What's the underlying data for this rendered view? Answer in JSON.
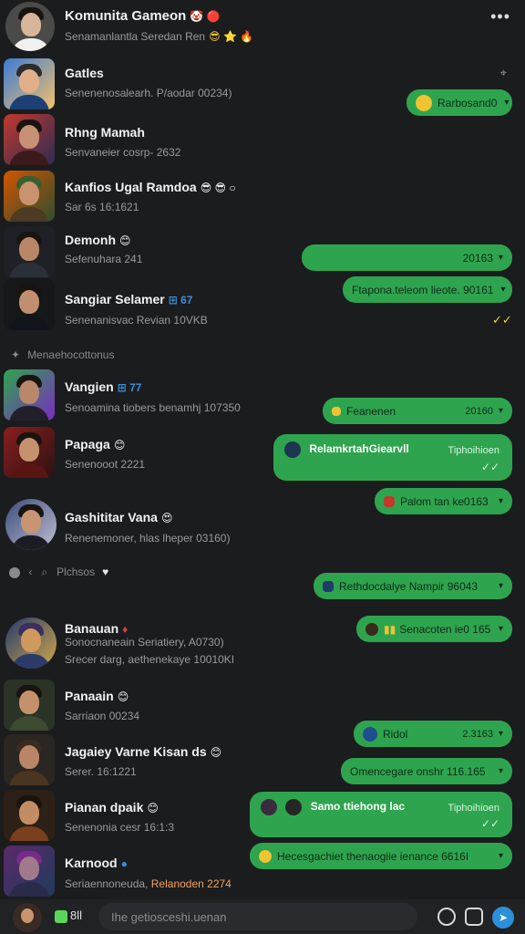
{
  "header": {
    "title": "Komunita Gameon",
    "subtitle": "Senamanlantla Seredan Ren"
  },
  "contacts": [
    {
      "name": "Gatles",
      "sub": "Senenenosalearh. P/aodar 00234)"
    },
    {
      "name": "Rhng Mamah",
      "sub": "Senvaneier cosrp- 2632"
    },
    {
      "name": "Kanfios Ugal Ramdoa",
      "sub": "Sar 6s 16:1621"
    },
    {
      "name": "Demonh",
      "sub": "Sefenuhara 241"
    },
    {
      "name": "Sangiar Selamer",
      "sub": "Senenanisvac Revian 10VKB"
    },
    {
      "name": "Vangien",
      "sub": "Senoamina tiobers benamhj 107350"
    },
    {
      "name": "Papaga",
      "sub": "Senenooot 2221"
    },
    {
      "name": "Gashititar Vana",
      "sub": "Renenemoner, hlas lheper 03160)"
    },
    {
      "name": "Banauan",
      "sub": "Sonocnaneain Seriatiery, A0730)"
    },
    {
      "name": "Panaain",
      "sub": "Sarriaon 00234"
    },
    {
      "name": "Jagaiey Varne Kisan ds",
      "sub": "Serer. 16:1221"
    },
    {
      "name": "Pianan dpaik",
      "sub": "Senenonia cesr 16:1:3"
    },
    {
      "name": "Karnood",
      "sub": "Seriaennoneuda,"
    }
  ],
  "extra_lines": {
    "banauan_line2": "Srecer darg, aethenekaye 10010KI",
    "karnood_highlight": "Relanoden 2274"
  },
  "separators": {
    "first": "Menaehocottonus",
    "second": "Plchsos"
  },
  "bubbles": {
    "b1": "Rarbosand0",
    "b2": "20163",
    "b3": "Ftapona.teleom lieote. 90161",
    "b4_text": "Feanenen",
    "b4_time": "20160",
    "b5_head": "RelamkrtahGiearvll",
    "b5_meta": "Tiphoihioen",
    "b6": "Palom tan ke0163",
    "b7": "Rethdocdalye Nampir 96043",
    "b8": "Senacoten ie0 165",
    "b9_text": "Ridol",
    "b9_time": "2.3163",
    "b10": "Omencegare onshr 116.165",
    "b11_head": "Samo ttiehong lac",
    "b11_meta": "Tiphoihioen",
    "b12": "Hecesgachiet thenaogiie ienance 6616I"
  },
  "footer": {
    "badge_text": "8ll",
    "input_placeholder": "Ihe getiosceshi.uenan"
  },
  "colors": {
    "background": "#1b1c1e",
    "bubble_green": "#2ea44f",
    "accent_blue": "#2b90d9"
  }
}
